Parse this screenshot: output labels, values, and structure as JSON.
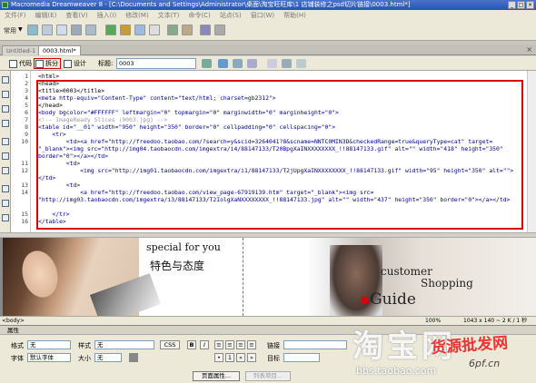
{
  "window": {
    "title": "Macromedia Dreamweaver 8 - [C:\\Documents and Settings\\Administrator\\桌面\\淘宝旺旺库\\1 店铺装修之psd切片链接\\0003.html*]"
  },
  "menu": [
    "文件(F)",
    "编辑(E)",
    "查看(V)",
    "插入(I)",
    "修改(M)",
    "文本(T)",
    "命令(C)",
    "站点(S)",
    "窗口(W)",
    "帮助(H)"
  ],
  "insert_bar": {
    "category": "常用"
  },
  "doc_tabs": [
    "Untitled-1",
    "0003.html*"
  ],
  "doc_toolbar": {
    "code_label": "代码",
    "split_label": "拆分",
    "design_label": "设计",
    "title_label": "标题:",
    "title_value": "0003"
  },
  "line_numbers": [
    "1",
    "2",
    "3",
    "4",
    "5",
    "6",
    "7",
    "8",
    "9",
    "10",
    "",
    "",
    "11",
    "12",
    "",
    "13",
    "14",
    "",
    "15",
    "16"
  ],
  "code_lines": [
    "<html>",
    "<head>",
    "<title>0003</title>",
    "<meta http-equiv=\"Content-Type\" content=\"text/html; charset=gb2312\">",
    "</head>",
    "<body bgcolor=\"#FFFFFF\" leftmargin=\"0\" topmargin=\"0\" marginwidth=\"0\" marginheight=\"0\">",
    "<!-- ImageReady Slices (0003.jpg) -->",
    "<table id=\"__01\" width=\"950\" height=\"350\" border=\"0\" cellpadding=\"0\" cellspacing=\"0\">",
    "    <tr>",
    "        <td><a href=\"http://freedoo.taobao.com/?search=y&scid=3264041?8&scname=NNTC0MIN3D&checkedRange=true&queryType=cat\" target=",
    "\"_blank\"><img src=\"http://img04.taobaocdn.com/imgextra/i4/88147133/T20BpgXaINXXXXXXXX_!!88147133.gif\" alt=\"\" width=\"418\" height=\"350\"",
    "border=\"0\"></a></td>",
    "        <td>",
    "            <img src=\"http://img01.taobaocdn.com/imgextra/i1/88147133/T2jUpgXaINXXXXXXXX_!!88147133.gif\" width=\"95\" height=\"350\" alt=\"\">",
    "</td>",
    "        <td>",
    "            <a href=\"http://freedoo.taobao.com/view_page-67919139.htm\" target=\"_blank\"><img src=",
    "\"http://img03.taobaocdn.com/imgextra/i3/88147133/T2IolgXaNXXXXXXXX_!!88147133.jpg\" alt=\"\" width=\"437\" height=\"350\" border=\"0\"></a></td>",
    "    </tr>",
    "</table>"
  ],
  "design_view": {
    "text1": "special for you",
    "text2": "特色与态度",
    "text3": "customer",
    "text4": "Shopping",
    "text5": "Guide"
  },
  "status_bar": {
    "tag": "<body>",
    "zoom": "100%",
    "size_info": "1043 x 140 ~ 2 K / 1 秒"
  },
  "properties": {
    "header": "属性",
    "format_label": "格式",
    "format_value": "无",
    "style_label": "样式",
    "style_value": "无",
    "css_label": "CSS",
    "bold": "B",
    "italic": "I",
    "link_label": "链接",
    "font_label": "字体",
    "font_value": "默认字体",
    "size_label": "大小",
    "size_value": "无",
    "target_label": "目标",
    "page_props_label": "页面属性...",
    "list_item_label": "列表项目..."
  },
  "watermarks": {
    "brand": "淘宝网",
    "url": "bbs.taobao.com",
    "red": "货源批发网",
    "site": "6pf.cn"
  },
  "colors": {
    "highlight_border": "#dd0000",
    "code_tag": "#00008b",
    "comment": "#999999"
  }
}
